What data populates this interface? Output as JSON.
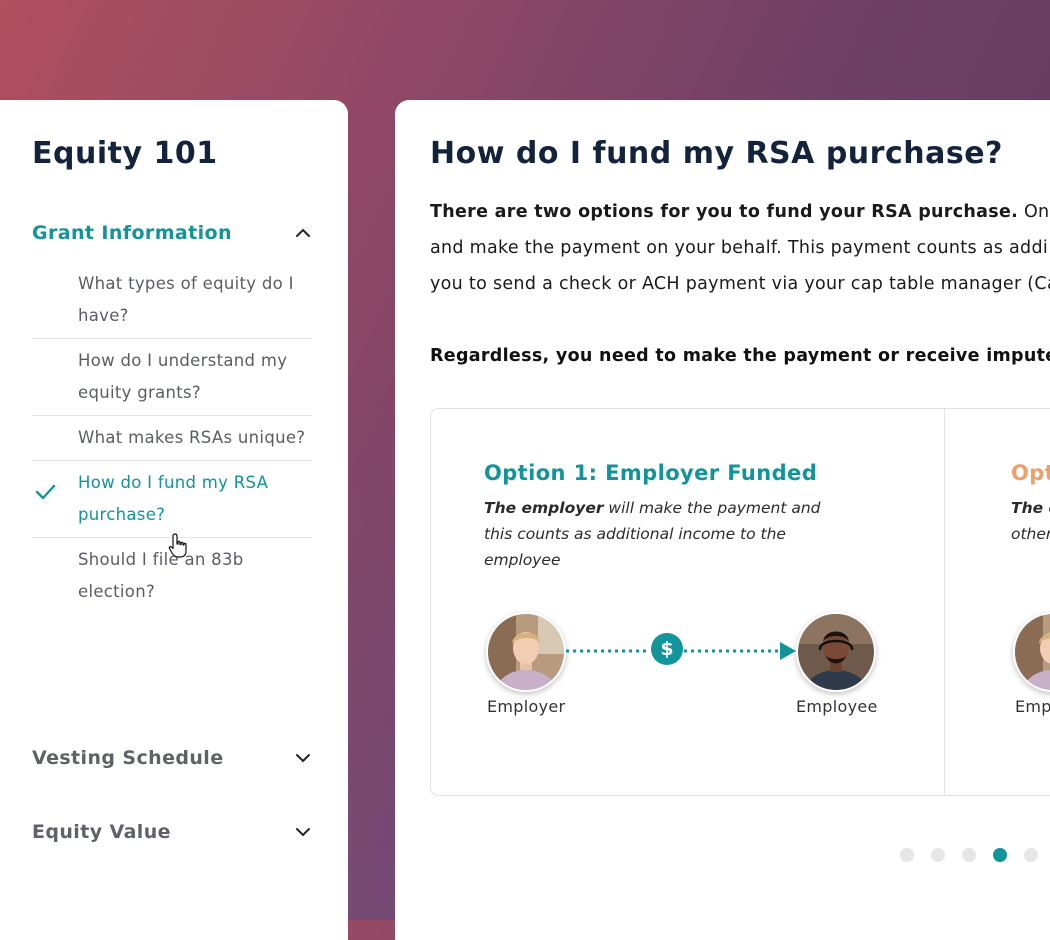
{
  "sidebar": {
    "title": "Equity 101",
    "sections": [
      {
        "label": "Grant Information",
        "expanded": true
      },
      {
        "label": "Vesting Schedule",
        "expanded": false
      },
      {
        "label": "Equity Value",
        "expanded": false
      }
    ],
    "items": [
      {
        "label": "What types of equity do I have?"
      },
      {
        "label": "How do I understand my equity grants?"
      },
      {
        "label": "What makes RSAs unique?"
      },
      {
        "label": "How do I fund my RSA purchase?",
        "active": true
      },
      {
        "label": "Should I file an 83b election?"
      }
    ]
  },
  "main": {
    "title": "How do I fund my RSA purchase?",
    "para_lead": "There are two options for you to fund your RSA purchase.",
    "para_line1_rest": " One opti",
    "para_line2": "and make the payment on your behalf. This payment counts as addi",
    "para_line3": "you to send a check or ACH payment via your cap table manager (Ca",
    "para2": "Regardless, you need to make the payment or receive imputed in",
    "option1": {
      "title": "Option 1: Employer Funded",
      "desc_bold": "The employer",
      "desc_rest": " will make the payment and this counts as additional income to the employee",
      "from_label": "Employer",
      "to_label": "Employee",
      "symbol": "$"
    },
    "option2": {
      "title": "Opt",
      "desc_bold": "The e",
      "desc_rest": "",
      "desc_line2": "other",
      "from_label": "Emp"
    },
    "pagination": {
      "count": 5,
      "active_index": 3
    }
  },
  "colors": {
    "accent": "#11949a",
    "orange": "#eea06a",
    "heading": "#14233c"
  }
}
